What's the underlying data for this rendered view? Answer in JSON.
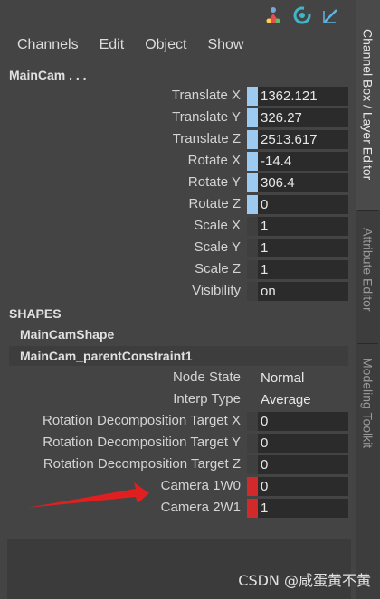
{
  "toolbar": {
    "icons": [
      "channel-select-icon",
      "refresh-icon",
      "edit-pen-icon"
    ]
  },
  "menu": [
    "Channels",
    "Edit",
    "Object",
    "Show"
  ],
  "node": {
    "title": "MainCam . . ."
  },
  "channels": [
    {
      "label": "Translate X",
      "value": "1362.121",
      "keyed": true
    },
    {
      "label": "Translate Y",
      "value": "326.27",
      "keyed": true
    },
    {
      "label": "Translate Z",
      "value": "2513.617",
      "keyed": true
    },
    {
      "label": "Rotate X",
      "value": "-14.4",
      "keyed": true
    },
    {
      "label": "Rotate Y",
      "value": "306.4",
      "keyed": true
    },
    {
      "label": "Rotate Z",
      "value": "0",
      "keyed": true
    },
    {
      "label": "Scale X",
      "value": "1",
      "keyed": false
    },
    {
      "label": "Scale Y",
      "value": "1",
      "keyed": false
    },
    {
      "label": "Scale Z",
      "value": "1",
      "keyed": false
    },
    {
      "label": "Visibility",
      "value": "on",
      "keyed": false
    }
  ],
  "shapes": {
    "title": "SHAPES",
    "items": [
      "MainCamShape",
      "MainCam_parentConstraint1"
    ]
  },
  "constraint": [
    {
      "label": "Node State",
      "value": "Normal"
    },
    {
      "label": "Interp Type",
      "value": "Average"
    },
    {
      "label": "Rotation Decomposition Target X",
      "value": "0"
    },
    {
      "label": "Rotation Decomposition Target Y",
      "value": "0"
    },
    {
      "label": "Rotation Decomposition Target Z",
      "value": "0"
    },
    {
      "label": "Camera 1W0",
      "value": "0"
    },
    {
      "label": "Camera 2W1",
      "value": "1"
    }
  ],
  "side_tabs": [
    "Channel Box / Layer Editor",
    "Attribute Editor",
    "Modeling Toolkit"
  ],
  "watermark": "CSDN @咸蛋黄不黄",
  "colors": {
    "keyed": "#9ccaf0",
    "constraint_weight": "#d22a2a",
    "arrow": "#e02020"
  }
}
